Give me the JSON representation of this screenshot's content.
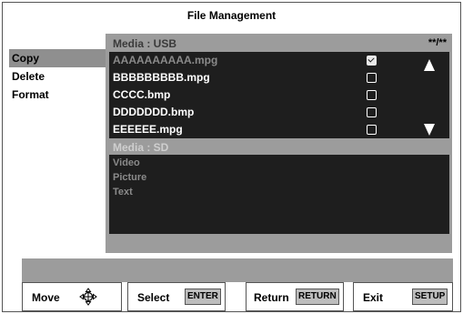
{
  "title": "File Management",
  "menu": [
    {
      "label": "Copy",
      "selected": true
    },
    {
      "label": "Delete",
      "selected": false
    },
    {
      "label": "Format",
      "selected": false
    }
  ],
  "usb": {
    "header": "Media : USB",
    "page": "**/**",
    "files": [
      {
        "name": "AAAAAAAAAA.mpg",
        "checked": true,
        "dim": true
      },
      {
        "name": "BBBBBBBBB.mpg",
        "checked": false,
        "dim": false
      },
      {
        "name": "CCCC.bmp",
        "checked": false,
        "dim": false
      },
      {
        "name": "DDDDDDD.bmp",
        "checked": false,
        "dim": false
      },
      {
        "name": "EEEEEE.mpg",
        "checked": false,
        "dim": false
      }
    ]
  },
  "sd": {
    "header": "Media : SD",
    "items": [
      "Video",
      "Picture",
      "Text"
    ]
  },
  "buttons": {
    "move": {
      "label": "Move",
      "icon": "move-cross-icon"
    },
    "select": {
      "label": "Select",
      "key": "ENTER"
    },
    "return": {
      "label": "Return",
      "key": "RETURN"
    },
    "exit": {
      "label": "Exit",
      "key": "SETUP"
    }
  },
  "colors": {
    "panel": "#9c9c9c",
    "list": "#1e1e1e",
    "selected": "#8f8f8f"
  }
}
